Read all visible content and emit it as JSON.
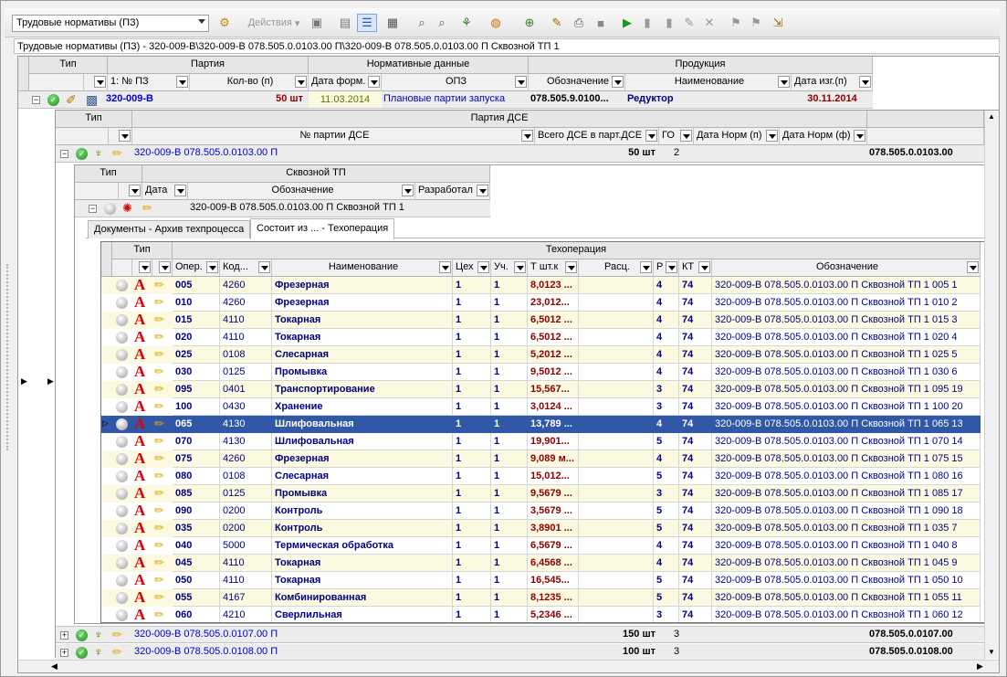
{
  "toolbar": {
    "mode_select": "Трудовые нормативы (ПЗ)",
    "actions_label": "Действия"
  },
  "path": "Трудовые нормативы (ПЗ) - 320-009-В\\320-009-В 078.505.0.0103.00 П\\320-009-В 078.505.0.0103.00 П Сквозной ТП 1",
  "level1": {
    "group_headers": {
      "type": "Тип",
      "party": "Партия",
      "norm_data": "Нормативные данные",
      "product": "Продукция"
    },
    "filters": {
      "sort": "1: № ПЗ",
      "qty": "Кол-во (п)",
      "date_form": "Дата форм.",
      "opz": "ОПЗ",
      "designation": "Обозначение",
      "name": "Наименование",
      "date_make": "Дата изг.(п)"
    },
    "row": {
      "number": "320-009-В",
      "qty": "50 шт",
      "date_form": "11.03.2014",
      "opz": "Плановые партии запуска",
      "designation": "078.505.9.0100...",
      "name": "Редуктор",
      "date_make": "30.11.2014"
    }
  },
  "level2": {
    "group_headers": {
      "type": "Тип",
      "party_dse": "Партия ДСЕ"
    },
    "filters": {
      "party_no": "№ партии ДСЕ",
      "total": "Всего ДСЕ в парт.ДСЕ",
      "go": "ГО",
      "date_norm_p": "Дата Норм (п)",
      "date_norm_f": "Дата Норм (ф)"
    },
    "rows": [
      {
        "party": "320-009-В 078.505.0.0103.00 П",
        "qty": "50 шт",
        "go": "2",
        "code": "078.505.0.0103.00"
      },
      {
        "party": "320-009-В 078.505.0.0107.00 П",
        "qty": "150 шт",
        "go": "3",
        "code": "078.505.0.0107.00"
      },
      {
        "party": "320-009-В 078.505.0.0108.00 П",
        "qty": "100 шт",
        "go": "3",
        "code": "078.505.0.0108.00"
      }
    ]
  },
  "level3": {
    "group_headers": {
      "type": "Тип",
      "tp": "Сквозной ТП"
    },
    "filters": {
      "date": "Дата",
      "designation": "Обозначение",
      "developer": "Разработал"
    },
    "row": {
      "designation": "320-009-В 078.505.0.0103.00 П Сквозной ТП 1"
    }
  },
  "tabs": [
    "Документы - Архив техпроцесса",
    "Состоит из ... - Техоперация"
  ],
  "ops": {
    "group_headers": {
      "type": "Тип",
      "op": "Техоперация"
    },
    "columns": {
      "oper": "Опер.",
      "code": "Код...",
      "name": "Наименование",
      "shop": "Цех",
      "sect": "Уч.",
      "t": "Т шт.к",
      "calc": "Расц.",
      "r": "Р",
      "kt": "КТ",
      "designation": "Обозначение"
    },
    "rows": [
      {
        "oper": "005",
        "code": "4260",
        "name": "Фрезерная",
        "shop": "1",
        "sect": "1",
        "t": "8,0123 ...",
        "r": "4",
        "kt": "74",
        "des": "320-009-В 078.505.0.0103.00 П Сквозной ТП 1 005 1"
      },
      {
        "oper": "010",
        "code": "4260",
        "name": "Фрезерная",
        "shop": "1",
        "sect": "1",
        "t": "23,012...",
        "r": "4",
        "kt": "74",
        "des": "320-009-В 078.505.0.0103.00 П Сквозной ТП 1 010 2"
      },
      {
        "oper": "015",
        "code": "4110",
        "name": "Токарная",
        "shop": "1",
        "sect": "1",
        "t": "6,5012 ...",
        "r": "4",
        "kt": "74",
        "des": "320-009-В 078.505.0.0103.00 П Сквозной ТП 1 015 3"
      },
      {
        "oper": "020",
        "code": "4110",
        "name": "Токарная",
        "shop": "1",
        "sect": "1",
        "t": "6,5012 ...",
        "r": "4",
        "kt": "74",
        "des": "320-009-В 078.505.0.0103.00 П Сквозной ТП 1 020 4"
      },
      {
        "oper": "025",
        "code": "0108",
        "name": "Слесарная",
        "shop": "1",
        "sect": "1",
        "t": "5,2012 ...",
        "r": "4",
        "kt": "74",
        "des": "320-009-В 078.505.0.0103.00 П Сквозной ТП 1 025 5"
      },
      {
        "oper": "030",
        "code": "0125",
        "name": "Промывка",
        "shop": "1",
        "sect": "1",
        "t": "9,5012 ...",
        "r": "4",
        "kt": "74",
        "des": "320-009-В 078.505.0.0103.00 П Сквозной ТП 1 030 6"
      },
      {
        "oper": "095",
        "code": "0401",
        "name": "Транспортирование",
        "shop": "1",
        "sect": "1",
        "t": "15,567...",
        "r": "3",
        "kt": "74",
        "des": "320-009-В 078.505.0.0103.00 П Сквозной ТП 1 095 19"
      },
      {
        "oper": "100",
        "code": "0430",
        "name": "Хранение",
        "shop": "1",
        "sect": "1",
        "t": "3,0124 ...",
        "r": "3",
        "kt": "74",
        "des": "320-009-В 078.505.0.0103.00 П Сквозной ТП 1 100 20"
      },
      {
        "oper": "065",
        "code": "4130",
        "name": "Шлифовальная",
        "shop": "1",
        "sect": "1",
        "t": "13,789 ...",
        "r": "4",
        "kt": "74",
        "des": "320-009-В 078.505.0.0103.00 П Сквозной ТП 1 065 13"
      },
      {
        "oper": "070",
        "code": "4130",
        "name": "Шлифовальная",
        "shop": "1",
        "sect": "1",
        "t": "19,901...",
        "r": "5",
        "kt": "74",
        "des": "320-009-В 078.505.0.0103.00 П Сквозной ТП 1 070 14"
      },
      {
        "oper": "075",
        "code": "4260",
        "name": "Фрезерная",
        "shop": "1",
        "sect": "1",
        "t": "9,089 м...",
        "r": "4",
        "kt": "74",
        "des": "320-009-В 078.505.0.0103.00 П Сквозной ТП 1 075 15"
      },
      {
        "oper": "080",
        "code": "0108",
        "name": "Слесарная",
        "shop": "1",
        "sect": "1",
        "t": "15,012...",
        "r": "5",
        "kt": "74",
        "des": "320-009-В 078.505.0.0103.00 П Сквозной ТП 1 080 16"
      },
      {
        "oper": "085",
        "code": "0125",
        "name": "Промывка",
        "shop": "1",
        "sect": "1",
        "t": "9,5679 ...",
        "r": "3",
        "kt": "74",
        "des": "320-009-В 078.505.0.0103.00 П Сквозной ТП 1 085 17"
      },
      {
        "oper": "090",
        "code": "0200",
        "name": "Контроль",
        "shop": "1",
        "sect": "1",
        "t": "3,5679 ...",
        "r": "5",
        "kt": "74",
        "des": "320-009-В 078.505.0.0103.00 П Сквозной ТП 1 090 18"
      },
      {
        "oper": "035",
        "code": "0200",
        "name": "Контроль",
        "shop": "1",
        "sect": "1",
        "t": "3,8901 ...",
        "r": "5",
        "kt": "74",
        "des": "320-009-В 078.505.0.0103.00 П Сквозной ТП 1 035 7"
      },
      {
        "oper": "040",
        "code": "5000",
        "name": "Термическая обработка",
        "shop": "1",
        "sect": "1",
        "t": "6,5679 ...",
        "r": "4",
        "kt": "74",
        "des": "320-009-В 078.505.0.0103.00 П Сквозной ТП 1 040 8"
      },
      {
        "oper": "045",
        "code": "4110",
        "name": "Токарная",
        "shop": "1",
        "sect": "1",
        "t": "6,4568 ...",
        "r": "4",
        "kt": "74",
        "des": "320-009-В 078.505.0.0103.00 П Сквозной ТП 1 045 9"
      },
      {
        "oper": "050",
        "code": "4110",
        "name": "Токарная",
        "shop": "1",
        "sect": "1",
        "t": "16,545...",
        "r": "5",
        "kt": "74",
        "des": "320-009-В 078.505.0.0103.00 П Сквозной ТП 1 050 10"
      },
      {
        "oper": "055",
        "code": "4167",
        "name": "Комбинированная",
        "shop": "1",
        "sect": "1",
        "t": "8,1235 ...",
        "r": "5",
        "kt": "74",
        "des": "320-009-В 078.505.0.0103.00 П Сквозной ТП 1 055 11"
      },
      {
        "oper": "060",
        "code": "4210",
        "name": "Сверлильная",
        "shop": "1",
        "sect": "1",
        "t": "5,2346 ...",
        "r": "3",
        "kt": "74",
        "des": "320-009-В 078.505.0.0103.00 П Сквозной ТП 1 060 12"
      }
    ],
    "selected_index": 8
  },
  "colors": {
    "stripe": "#fbf9e0",
    "selected": "#3158a6",
    "header": "#e6e6e6"
  }
}
